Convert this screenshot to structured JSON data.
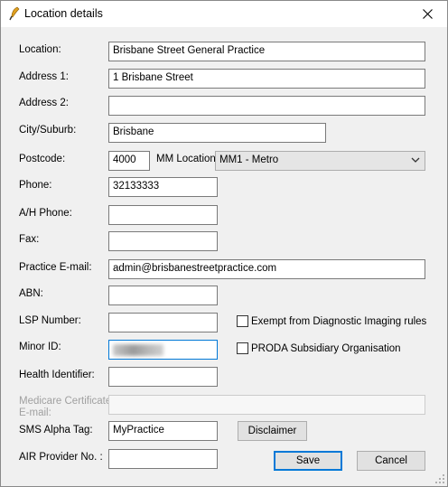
{
  "window": {
    "title": "Location details"
  },
  "fields": {
    "location": {
      "label": "Location:",
      "value": "Brisbane Street General Practice"
    },
    "address1": {
      "label": "Address 1:",
      "value": "1 Brisbane Street"
    },
    "address2": {
      "label": "Address 2:",
      "value": ""
    },
    "city": {
      "label": "City/Suburb:",
      "value": "Brisbane"
    },
    "postcode": {
      "label": "Postcode:",
      "value": "4000"
    },
    "mm_location": {
      "label": "MM Location:",
      "value": "MM1 - Metro"
    },
    "phone": {
      "label": "Phone:",
      "value": "32133333"
    },
    "ah_phone": {
      "label": "A/H Phone:",
      "value": ""
    },
    "fax": {
      "label": "Fax:",
      "value": ""
    },
    "practice_email": {
      "label": "Practice E-mail:",
      "value": "admin@brisbanestreetpractice.com"
    },
    "abn": {
      "label": "ABN:",
      "value": ""
    },
    "lsp_number": {
      "label": "LSP Number:",
      "value": ""
    },
    "minor_id": {
      "label": "Minor ID:"
    },
    "health_identifier": {
      "label": "Health Identifier:",
      "value": ""
    },
    "medicare_cert_email": {
      "label_line1": "Medicare Certificate",
      "label_line2": "E-mail:",
      "value": ""
    },
    "sms_alpha_tag": {
      "label": "SMS Alpha Tag:",
      "value": "MyPractice"
    },
    "air_provider": {
      "label": "AIR Provider No. :",
      "value": ""
    }
  },
  "checkboxes": {
    "exempt_di": {
      "label": "Exempt from Diagnostic Imaging rules",
      "checked": false
    },
    "proda": {
      "label": "PRODA Subsidiary Organisation",
      "checked": false
    }
  },
  "buttons": {
    "disclaimer": "Disclaimer",
    "save": "Save",
    "cancel": "Cancel"
  },
  "icons": {
    "app": "feather-pen-icon",
    "close": "close-icon",
    "dropdown": "chevron-down-icon",
    "resize": "resize-grip-icon"
  },
  "colors": {
    "focus_border": "#0078d7",
    "button_face": "#e1e1e1",
    "dialog_bg": "#f0f0f0"
  }
}
